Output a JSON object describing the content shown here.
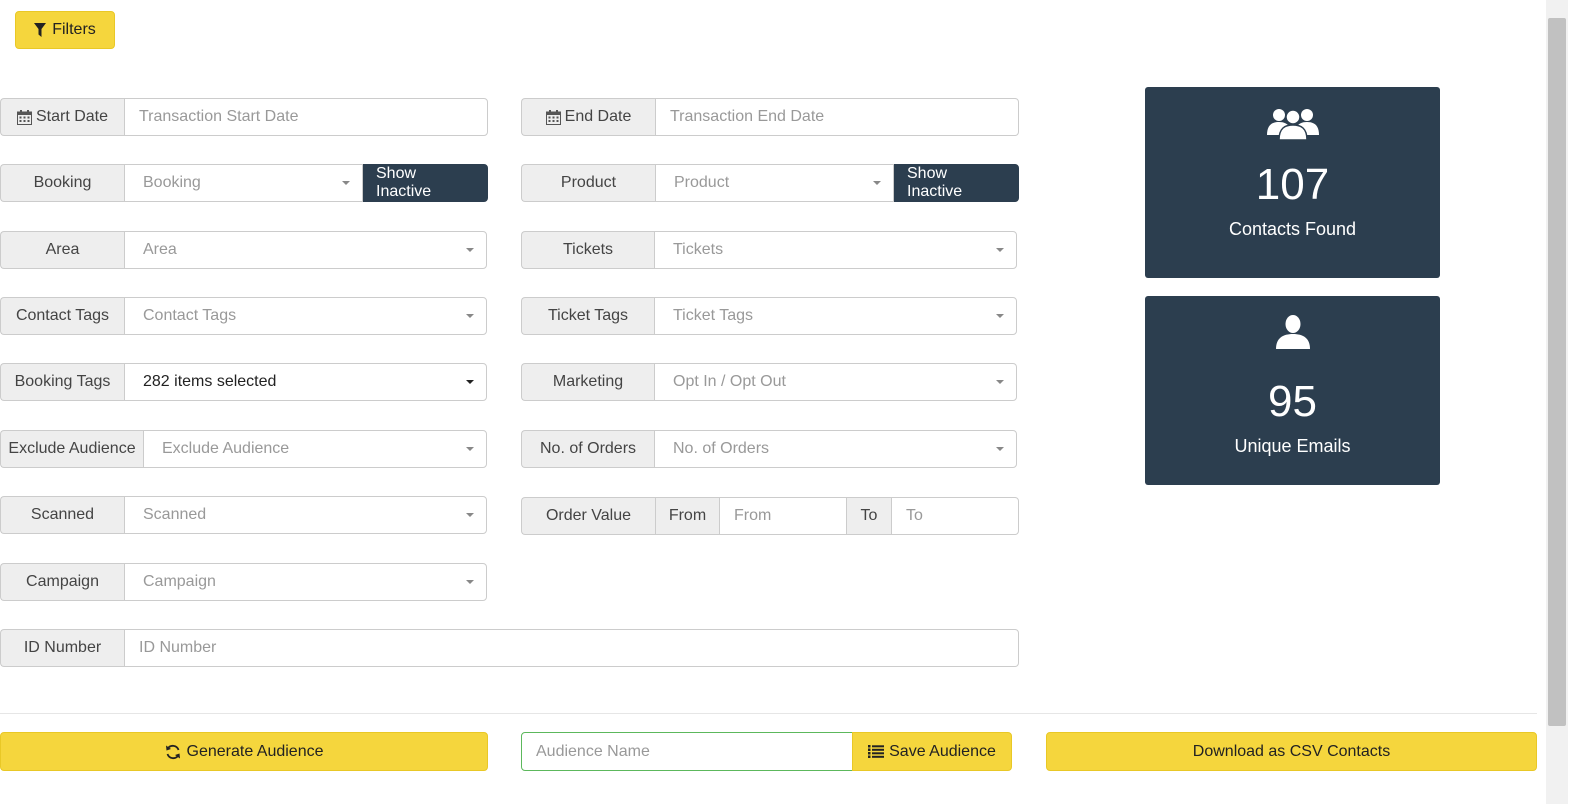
{
  "filters_button": {
    "label": "Filters",
    "icon": "filter-icon"
  },
  "left_column": [
    {
      "id": "start-date",
      "label": "Start Date",
      "icon": "calendar-icon",
      "placeholder": "Transaction Start Date",
      "type": "input"
    },
    {
      "id": "booking",
      "label": "Booking",
      "placeholder": "Booking",
      "type": "select",
      "button": "Show Inactive"
    },
    {
      "id": "area",
      "label": "Area",
      "placeholder": "Area",
      "type": "select"
    },
    {
      "id": "contact-tags",
      "label": "Contact Tags",
      "placeholder": "Contact Tags",
      "type": "select"
    },
    {
      "id": "booking-tags",
      "label": "Booking Tags",
      "value": "282 items selected",
      "type": "select"
    },
    {
      "id": "exclude-audience",
      "label": "Exclude Audience",
      "placeholder": "Exclude Audience",
      "type": "select"
    },
    {
      "id": "scanned",
      "label": "Scanned",
      "placeholder": "Scanned",
      "type": "select"
    },
    {
      "id": "campaign",
      "label": "Campaign",
      "placeholder": "Campaign",
      "type": "select"
    },
    {
      "id": "id-number",
      "label": "ID Number",
      "placeholder": "ID Number",
      "type": "input"
    }
  ],
  "right_column": [
    {
      "id": "end-date",
      "label": "End Date",
      "icon": "calendar-icon",
      "placeholder": "Transaction End Date",
      "type": "input"
    },
    {
      "id": "product",
      "label": "Product",
      "placeholder": "Product",
      "type": "select",
      "button": "Show Inactive"
    },
    {
      "id": "tickets",
      "label": "Tickets",
      "placeholder": "Tickets",
      "type": "select"
    },
    {
      "id": "ticket-tags",
      "label": "Ticket Tags",
      "placeholder": "Ticket Tags",
      "type": "select"
    },
    {
      "id": "marketing",
      "label": "Marketing",
      "placeholder": "Opt In / Opt Out",
      "type": "select"
    },
    {
      "id": "no-of-orders",
      "label": "No. of Orders",
      "placeholder": "No. of Orders",
      "type": "select"
    },
    {
      "id": "order-value",
      "label": "Order Value",
      "from_label": "From",
      "from_placeholder": "From",
      "to_label": "To",
      "to_placeholder": "To",
      "type": "range"
    }
  ],
  "stats": [
    {
      "value": "107",
      "label": "Contacts Found",
      "icon": "users-group-icon"
    },
    {
      "value": "95",
      "label": "Unique Emails",
      "icon": "user-icon"
    }
  ],
  "bottom": {
    "generate_label": "Generate Audience",
    "audience_name_placeholder": "Audience Name",
    "save_label": "Save Audience",
    "download_label": "Download as CSV Contacts"
  },
  "colors": {
    "accent": "#f5d63d",
    "dark": "#2c3e4f",
    "addon": "#eeeeee"
  }
}
